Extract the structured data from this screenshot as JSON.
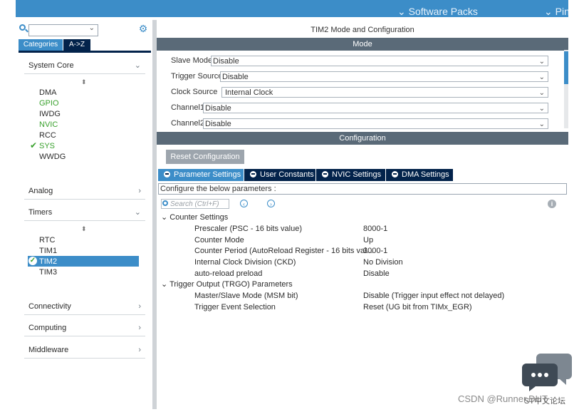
{
  "topbar": {
    "menu1": "Software Packs",
    "menu2": "Pino"
  },
  "sidebar": {
    "tabs": [
      {
        "label": "Categories",
        "active": true
      },
      {
        "label": "A->Z",
        "active": false
      }
    ],
    "sections": [
      {
        "label": "System Core",
        "expanded": true
      },
      {
        "label": "Analog",
        "expanded": false
      },
      {
        "label": "Timers",
        "expanded": true
      },
      {
        "label": "Connectivity",
        "expanded": false
      },
      {
        "label": "Computing",
        "expanded": false
      },
      {
        "label": "Middleware",
        "expanded": false
      }
    ],
    "system_core_items": [
      {
        "label": "DMA",
        "state": "normal"
      },
      {
        "label": "GPIO",
        "state": "green"
      },
      {
        "label": "IWDG",
        "state": "normal"
      },
      {
        "label": "NVIC",
        "state": "green"
      },
      {
        "label": "RCC",
        "state": "normal"
      },
      {
        "label": "SYS",
        "state": "checked"
      },
      {
        "label": "WWDG",
        "state": "normal"
      }
    ],
    "timer_items": [
      {
        "label": "RTC",
        "state": "normal"
      },
      {
        "label": "TIM1",
        "state": "normal"
      },
      {
        "label": "TIM2",
        "state": "selected"
      },
      {
        "label": "TIM3",
        "state": "normal"
      }
    ]
  },
  "main": {
    "title": "TIM2 Mode and Configuration",
    "mode_header": "Mode",
    "mode_rows": [
      {
        "label": "Slave Mode",
        "value": "Disable"
      },
      {
        "label": "Trigger Source",
        "value": "Disable"
      },
      {
        "label": "Clock Source",
        "value": "Internal Clock"
      },
      {
        "label": "Channel1",
        "value": "Disable"
      },
      {
        "label": "Channel2",
        "value": "Disable"
      }
    ],
    "config_header": "Configuration",
    "reset_button": "Reset Configuration",
    "config_tabs": [
      {
        "label": "Parameter Settings",
        "active": true
      },
      {
        "label": "User Constants",
        "active": false
      },
      {
        "label": "NVIC Settings",
        "active": false
      },
      {
        "label": "DMA Settings",
        "active": false
      }
    ],
    "description": "Configure the below parameters :",
    "search_placeholder": "Search (Ctrl+F)",
    "groups": [
      {
        "label": "Counter Settings",
        "params": [
          {
            "name": "Prescaler (PSC - 16 bits value)",
            "value": "8000-1"
          },
          {
            "name": "Counter Mode",
            "value": "Up"
          },
          {
            "name": "Counter Period (AutoReload Register - 16 bits val...",
            "value": "3000-1"
          },
          {
            "name": "Internal Clock Division (CKD)",
            "value": "No Division"
          },
          {
            "name": "auto-reload preload",
            "value": "Disable"
          }
        ]
      },
      {
        "label": "Trigger Output (TRGO) Parameters",
        "params": [
          {
            "name": "Master/Slave Mode (MSM bit)",
            "value": "Disable (Trigger input effect not delayed)"
          },
          {
            "name": "Trigger Event Selection",
            "value": "Reset (UG bit from TIMx_EGR)"
          }
        ]
      }
    ]
  },
  "watermark": {
    "text": "CSDN @Runner.DUT",
    "overlay": "ST中文论坛"
  },
  "colors": {
    "accent": "#3c8dc8",
    "dark": "#03234b",
    "header": "#5a6a78",
    "green": "#39a12d"
  }
}
